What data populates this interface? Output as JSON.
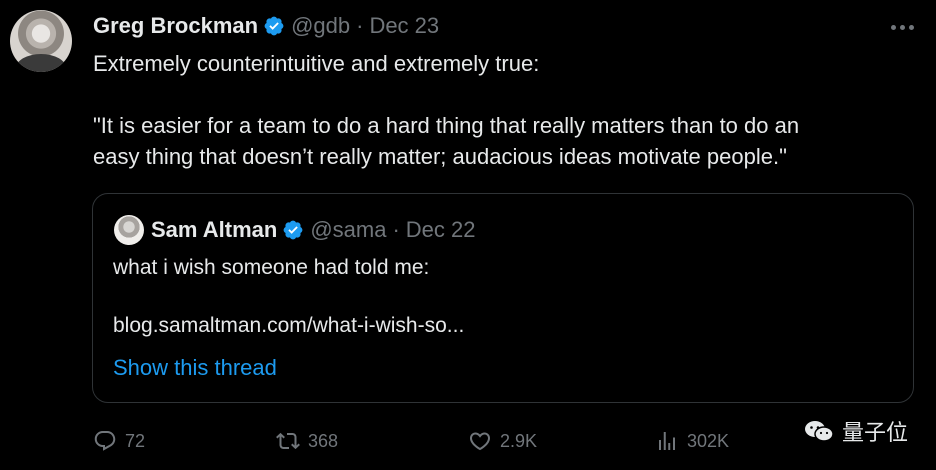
{
  "tweet": {
    "author_name": "Greg Brockman",
    "handle": "@gdb",
    "separator": "·",
    "date": "Dec 23",
    "text_lines": [
      "Extremely counterintuitive and extremely true:",
      "\"It is easier for a team to do a hard thing that really matters than to do an",
      "easy thing that doesn’t really matter; audacious ideas motivate people.\""
    ]
  },
  "quoted_tweet": {
    "author_name": "Sam Altman",
    "handle": "@sama",
    "separator": "·",
    "date": "Dec 22",
    "text": "what i wish someone had told me:",
    "link": "blog.samaltman.com/what-i-wish-so...",
    "show_thread": "Show this thread"
  },
  "actions": {
    "replies": "72",
    "retweets": "368",
    "likes": "2.9K",
    "views": "302K"
  },
  "watermark": {
    "text": "量子位"
  },
  "colors": {
    "background": "#000000",
    "text": "#e7e9ea",
    "muted": "#71767b",
    "accent": "#1d9bf0",
    "border": "#2f3336"
  }
}
